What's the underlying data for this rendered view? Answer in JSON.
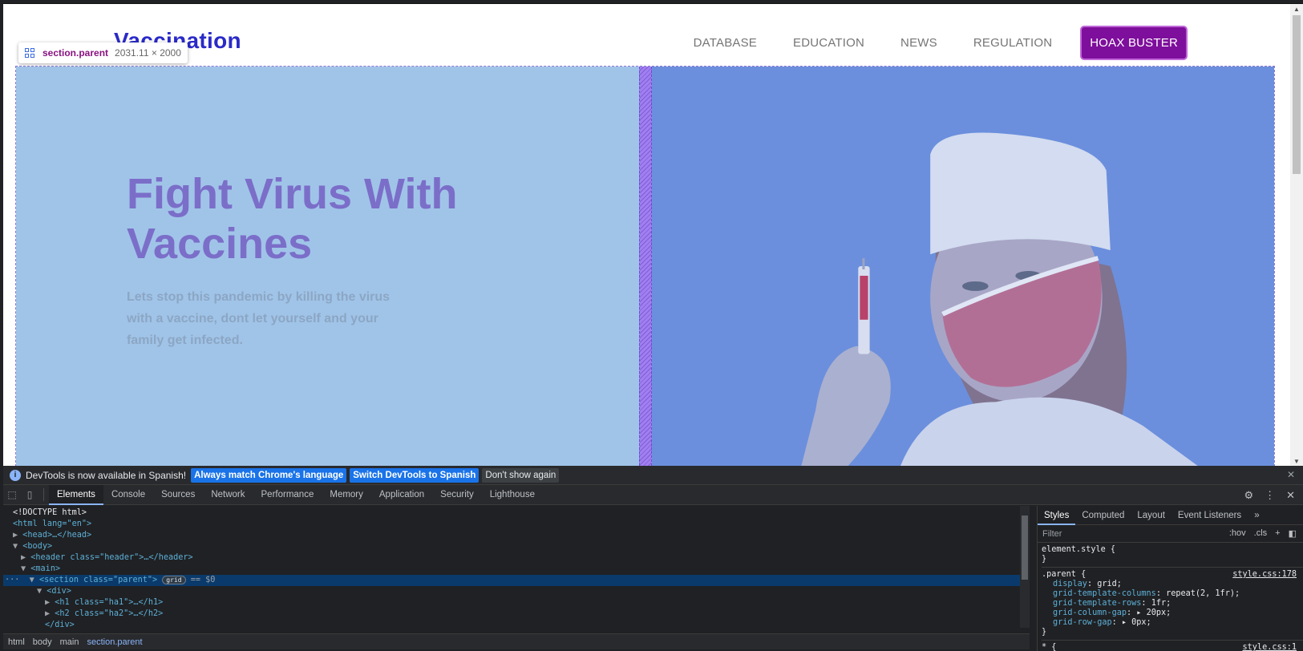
{
  "site": {
    "logo": "Vaccination",
    "nav": [
      "DATABASE",
      "EDUCATION",
      "NEWS",
      "REGULATION"
    ],
    "cta": "HOAX BUSTER",
    "heading": "Fight Virus With Vaccines",
    "subheading": "Lets stop this pandemic by killing the virus with a vaccine, dont let yourself and your family get infected."
  },
  "inspect_tooltip": {
    "selector": "section.parent",
    "size": "2031.11 × 2000"
  },
  "devtools": {
    "infobar": {
      "message": "DevTools is now available in Spanish!",
      "btn_match": "Always match Chrome's language",
      "btn_switch": "Switch DevTools to Spanish",
      "btn_dismiss": "Don't show again"
    },
    "tabs": [
      "Elements",
      "Console",
      "Sources",
      "Network",
      "Performance",
      "Memory",
      "Application",
      "Security",
      "Lighthouse"
    ],
    "dom": {
      "doctype": "<!DOCTYPE html>",
      "html_open": "<html lang=\"en\">",
      "head": "<head>…</head>",
      "body": "<body>",
      "header": "<header class=\"header\">…</header>",
      "main": "<main>",
      "section_open": "<section class=\"parent\">",
      "grid_badge": "grid",
      "selected_marker": "== $0",
      "div": "<div>",
      "h1": "<h1 class=\"ha1\">…</h1>",
      "h2": "<h2 class=\"ha2\">…</h2>",
      "div_close": "</div>"
    },
    "breadcrumb": [
      "html",
      "body",
      "main",
      "section.parent"
    ],
    "styles_panel": {
      "tabs": [
        "Styles",
        "Computed",
        "Layout",
        "Event Listeners"
      ],
      "filter_placeholder": "Filter",
      "hov": ":hov",
      "cls": ".cls",
      "element_style": "element.style {",
      "close_brace": "}",
      "rule_selector": ".parent {",
      "rule_source": "style.css:178",
      "declarations": [
        {
          "prop": "display",
          "value": "grid;"
        },
        {
          "prop": "grid-template-columns",
          "value": "repeat(2, 1fr);"
        },
        {
          "prop": "grid-template-rows",
          "value": "1fr;"
        },
        {
          "prop": "grid-column-gap",
          "value": "20px;"
        },
        {
          "prop": "grid-row-gap",
          "value": "0px;"
        }
      ],
      "next_rule_selector": "* {",
      "next_rule_source": "style.css:1"
    }
  }
}
